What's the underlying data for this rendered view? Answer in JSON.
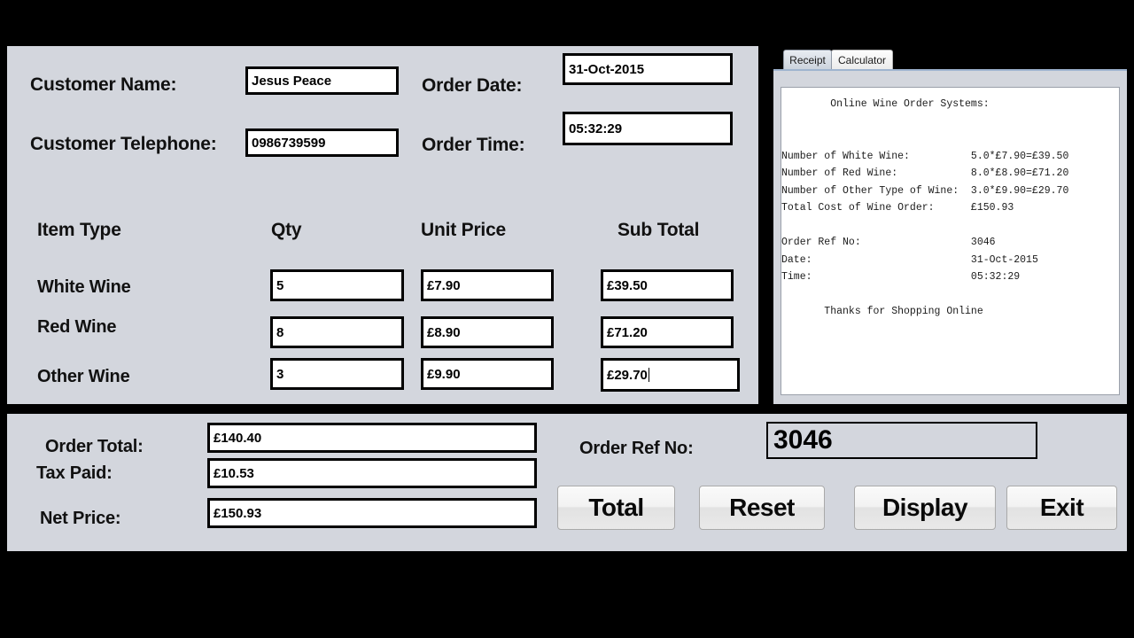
{
  "app": {
    "background_color": "#000000",
    "panel_color": "#d3d6dd"
  },
  "order_form": {
    "customer_name_label": "Customer Name:",
    "customer_name_value": "Jesus Peace",
    "customer_name_placeholder": "",
    "customer_telephone_label": "Customer Telephone:",
    "customer_telephone_value": "0986739599",
    "customer_telephone_placeholder": "",
    "order_date_label": "Order Date:",
    "order_date_value": "31-Oct-2015",
    "order_time_label": "Order Time:",
    "order_time_value": "05:32:29",
    "columns": {
      "item_type": "Item Type",
      "qty": "Qty",
      "unit_price": "Unit Price",
      "sub_total": "Sub Total"
    },
    "rows": [
      {
        "item_type": "White Wine",
        "qty": "5",
        "unit_price": "£7.90",
        "sub_total": "£39.50",
        "has_caret": false
      },
      {
        "item_type": "Red Wine",
        "qty": "8",
        "unit_price": "£8.90",
        "sub_total": "£71.20",
        "has_caret": false
      },
      {
        "item_type": "Other  Wine",
        "qty": "3",
        "unit_price": "£9.90",
        "sub_total": "£29.70",
        "has_caret": true
      }
    ]
  },
  "receipt_panel": {
    "tabs": [
      {
        "label": "Receipt",
        "selected": true
      },
      {
        "label": "Calculator",
        "selected": false
      }
    ],
    "receipt_text": "        Online Wine Order Systems:\n\n\nNumber of White Wine:          5.0*£7.90=£39.50\nNumber of Red Wine:            8.0*£8.90=£71.20\nNumber of Other Type of Wine:  3.0*£9.90=£29.70\nTotal Cost of Wine Order:      £150.93\n\nOrder Ref No:                  3046\nDate:                          31-Oct-2015\nTime:                          05:32:29\n\n       Thanks for Shopping Online"
  },
  "totals_panel": {
    "order_total_label": "Order Total:",
    "order_total_value": "£140.40",
    "tax_paid_label": "Tax Paid:",
    "tax_paid_value": "£10.53",
    "net_price_label": "Net Price:",
    "net_price_value": "£150.93",
    "order_ref_label": "Order Ref No:",
    "order_ref_value": "3046",
    "buttons": [
      {
        "label": "Total"
      },
      {
        "label": "Reset"
      },
      {
        "label": "Display"
      },
      {
        "label": "Exit"
      }
    ]
  }
}
